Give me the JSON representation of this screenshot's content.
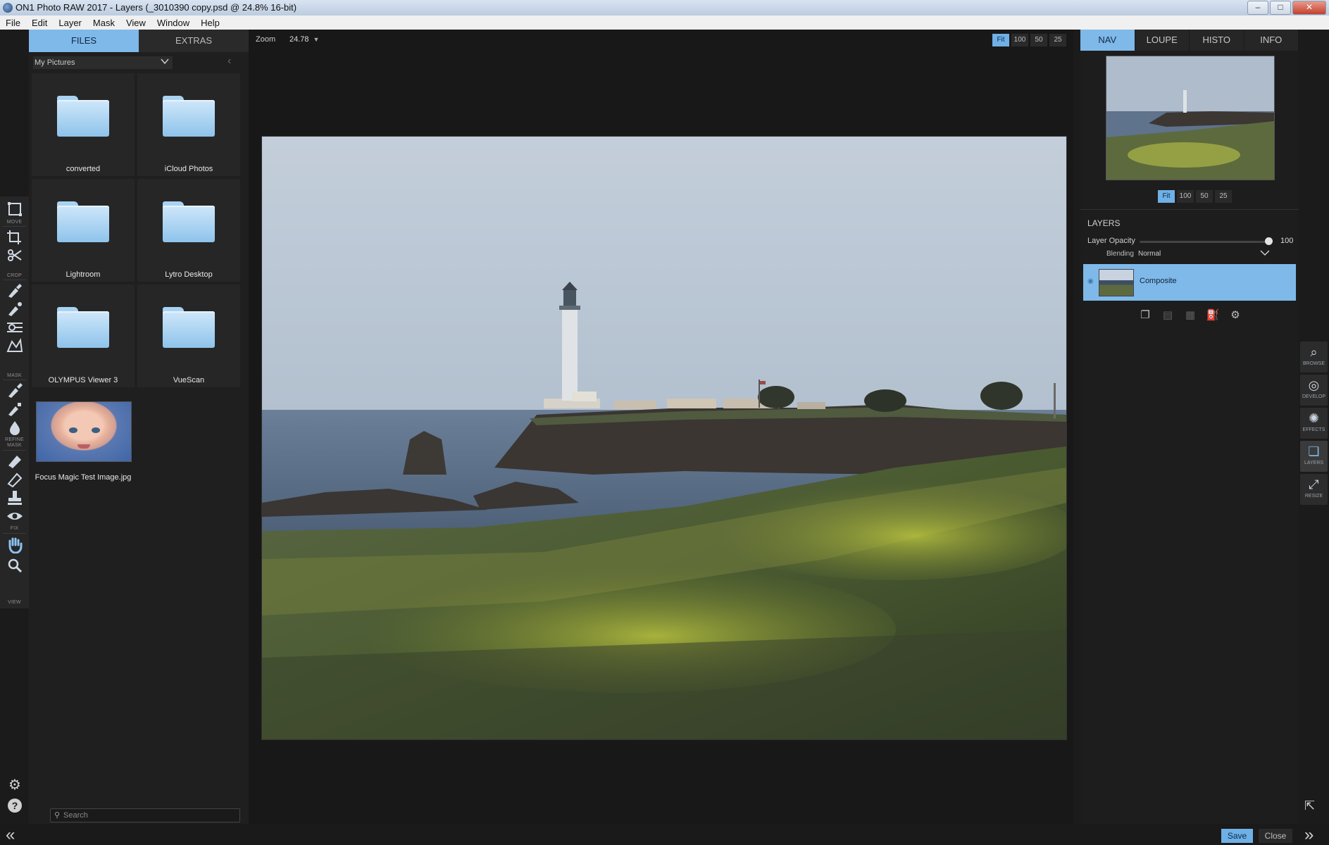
{
  "window": {
    "title": "ON1 Photo RAW 2017 - Layers (_3010390 copy.psd @ 24.8% 16-bit)"
  },
  "menu": [
    "File",
    "Edit",
    "Layer",
    "Mask",
    "View",
    "Window",
    "Help"
  ],
  "left_panel": {
    "tabs": [
      "FILES",
      "EXTRAS"
    ],
    "location": "My Pictures",
    "folders": [
      "converted",
      "iCloud Photos",
      "Lightroom",
      "Lytro Desktop",
      "OLYMPUS Viewer 3",
      "VueScan"
    ],
    "files": [
      "Focus Magic Test Image.jpg"
    ],
    "search_placeholder": "Search"
  },
  "toolbar_labels": [
    "MOVE",
    "CROP",
    "MASK",
    "REFINE MASK",
    "FIX",
    "VIEW"
  ],
  "zoom": {
    "label": "Zoom",
    "value": "24.78",
    "presets": [
      "Fit",
      "100",
      "50",
      "25"
    ],
    "active": "Fit"
  },
  "right_panel": {
    "nav_tabs": [
      "NAV",
      "LOUPE",
      "HISTO",
      "INFO"
    ],
    "nav_zoom_presets": [
      "Fit",
      "100",
      "50",
      "25"
    ],
    "layers": {
      "title": "LAYERS",
      "opacity_label": "Layer Opacity",
      "opacity": 100,
      "opacity_display": "100",
      "blending_label": "Blending",
      "blending_mode": "Normal",
      "layer_name": "Composite"
    }
  },
  "modules": [
    "BROWSE",
    "DEVELOP",
    "EFFECTS",
    "LAYERS",
    "RESIZE"
  ],
  "active_module": "LAYERS",
  "buttons": {
    "save": "Save",
    "close": "Close"
  },
  "colors": {
    "accent": "#7fb9ea",
    "background": "#1b1b1b"
  }
}
